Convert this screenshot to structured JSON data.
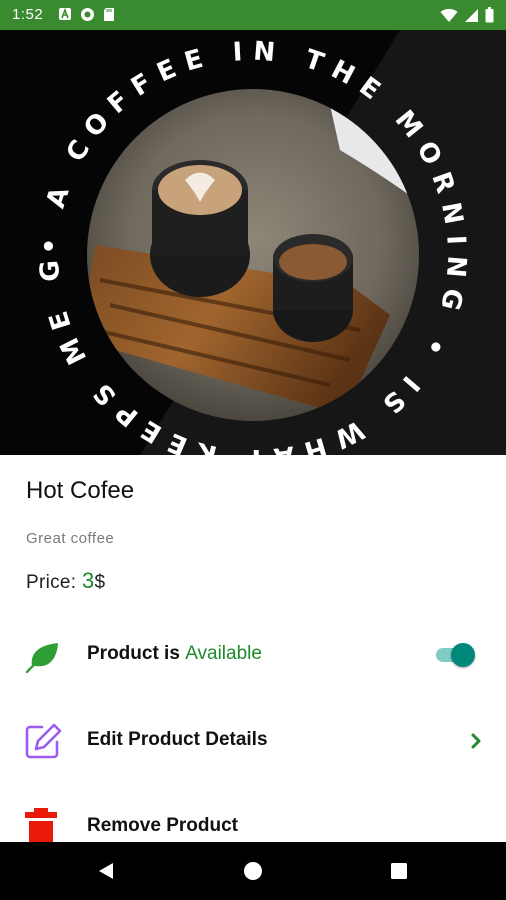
{
  "status_bar": {
    "time": "1:52",
    "background": "#3a8b2f"
  },
  "hero": {
    "image_alt": "Two cups of coffee on a wooden board in a circular frame",
    "ring_text": "• A COFFEE IN THE MORNING • IS WHAT KEEPS ME GOING"
  },
  "product": {
    "name": "Hot Cofee",
    "description": "Great coffee",
    "price_label": "Price:",
    "price_value": "3",
    "price_currency": "$"
  },
  "rows": {
    "availability_prefix": "Product is ",
    "availability_status": "Available",
    "availability_on": true,
    "edit_label": "Edit Product Details",
    "remove_label": "Remove Product"
  },
  "icons": {
    "availability": "leaf-icon",
    "edit": "edit-icon",
    "remove": "trash-icon",
    "chevron": "chevron-right-icon"
  },
  "colors": {
    "accent_green": "#1e8a2c",
    "toggle_on": "#00897b",
    "edit_icon": "#9c5cf0",
    "remove_icon": "#e8190b"
  }
}
